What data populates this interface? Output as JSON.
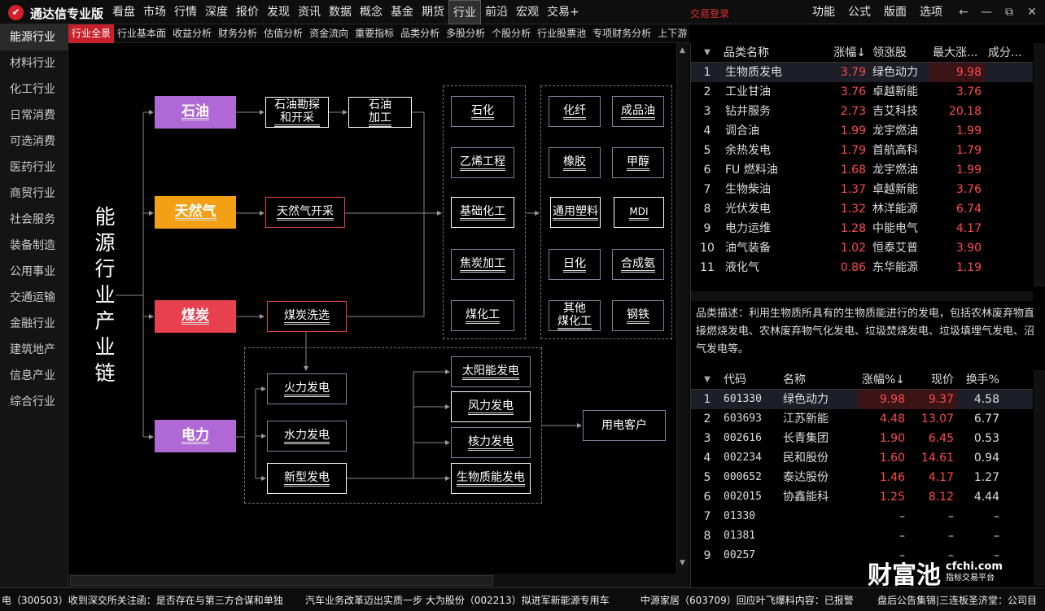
{
  "app": {
    "logo_glyph": "✔",
    "title": "通达信专业版"
  },
  "top_menu": [
    "看盘",
    "市场",
    "行情",
    "深度",
    "报价",
    "发现",
    "资讯",
    "数据",
    "概念",
    "基金",
    "期货",
    "行业",
    "前沿",
    "宏观",
    "交易+"
  ],
  "login_link": "交易登录",
  "right_menu": [
    "功能",
    "公式",
    "版面",
    "选项"
  ],
  "window_controls": [
    "←",
    "—",
    "⧉",
    "✕"
  ],
  "sidebar": [
    "能源行业",
    "材料行业",
    "化工行业",
    "日常消费",
    "可选消费",
    "医药行业",
    "商贸行业",
    "社会服务",
    "装备制造",
    "公用事业",
    "交通运输",
    "金融行业",
    "建筑地产",
    "信息产业",
    "综合行业"
  ],
  "sub_tabs": [
    "行业全景",
    "行业基本面",
    "收益分析",
    "财务分析",
    "估值分析",
    "资金流向",
    "重要指标",
    "品类分析",
    "多股分析",
    "个股分析",
    "行业股票池",
    "专项财务分析",
    "上下游"
  ],
  "diagram": {
    "chain_title": "能源行业产业链",
    "sources": {
      "oil": "石油",
      "gas": "天然气",
      "coal": "煤炭",
      "power": "电力"
    },
    "oil_steps": {
      "explore": "石油勘探\n和开采",
      "process": "石油\n加工"
    },
    "gas_step": "天然气开采",
    "coal_step": "煤炭洗选",
    "mid": [
      "石化",
      "乙烯工程",
      "基础化工",
      "焦炭加工",
      "煤化工"
    ],
    "products_left": [
      "化纤",
      "橡胶",
      "通用塑料",
      "日化",
      "其他\n煤化工"
    ],
    "products_right": [
      "成品油",
      "甲醇",
      "MDI",
      "合成氨",
      "钢铁"
    ],
    "power_gen": [
      "火力发电",
      "水力发电",
      "新型发电"
    ],
    "new_energy": [
      "太阳能发电",
      "风力发电",
      "核力发电",
      "生物质能发电"
    ],
    "customer": "用电客户"
  },
  "category_table": {
    "headers": {
      "name": "品类名称",
      "chg": "涨幅↓",
      "leader": "领涨股",
      "max": "最大涨...",
      "comp": "成分..."
    },
    "rows": [
      {
        "idx": "1",
        "name": "生物质发电",
        "chg": "3.79",
        "leader": "绿色动力",
        "max": "9.98"
      },
      {
        "idx": "2",
        "name": "工业甘油",
        "chg": "3.76",
        "leader": "卓越新能",
        "max": "3.76"
      },
      {
        "idx": "3",
        "name": "钻井服务",
        "chg": "2.73",
        "leader": "吉艾科技",
        "max": "20.18"
      },
      {
        "idx": "4",
        "name": "调合油",
        "chg": "1.99",
        "leader": "龙宇燃油",
        "max": "1.99"
      },
      {
        "idx": "5",
        "name": "余热发电",
        "chg": "1.79",
        "leader": "首航高科",
        "max": "1.79"
      },
      {
        "idx": "6",
        "name": "FU 燃料油",
        "chg": "1.68",
        "leader": "龙宇燃油",
        "max": "1.99"
      },
      {
        "idx": "7",
        "name": "生物柴油",
        "chg": "1.37",
        "leader": "卓越新能",
        "max": "3.76"
      },
      {
        "idx": "8",
        "name": "光伏发电",
        "chg": "1.32",
        "leader": "林洋能源",
        "max": "6.74"
      },
      {
        "idx": "9",
        "name": "电力运维",
        "chg": "1.28",
        "leader": "中能电气",
        "max": "4.17"
      },
      {
        "idx": "10",
        "name": "油气装备",
        "chg": "1.02",
        "leader": "恒泰艾普",
        "max": "3.90"
      },
      {
        "idx": "11",
        "name": "液化气",
        "chg": "0.86",
        "leader": "东华能源",
        "max": "1.19"
      }
    ]
  },
  "description": "品类描述：利用生物质所具有的生物质能进行的发电，包括农林废弃物直接燃烧发电、农林废弃物气化发电、垃圾焚烧发电、垃圾填埋气发电、沼气发电等。",
  "stock_table": {
    "headers": {
      "code": "代码",
      "name": "名称",
      "chg": "涨幅%↓",
      "price": "现价",
      "turnover": "换手%"
    },
    "rows": [
      {
        "idx": "1",
        "code": "601330",
        "name": "绿色动力",
        "chg": "9.98",
        "price": "9.37",
        "turnover": "4.58"
      },
      {
        "idx": "2",
        "code": "603693",
        "name": "江苏新能",
        "chg": "4.48",
        "price": "13.07",
        "turnover": "6.77"
      },
      {
        "idx": "3",
        "code": "002616",
        "name": "长青集团",
        "chg": "1.90",
        "price": "6.45",
        "turnover": "0.53"
      },
      {
        "idx": "4",
        "code": "002234",
        "name": "民和股份",
        "chg": "1.60",
        "price": "14.61",
        "turnover": "0.94"
      },
      {
        "idx": "5",
        "code": "000652",
        "name": "泰达股份",
        "chg": "1.46",
        "price": "4.17",
        "turnover": "1.27"
      },
      {
        "idx": "6",
        "code": "002015",
        "name": "协鑫能科",
        "chg": "1.25",
        "price": "8.12",
        "turnover": "4.44"
      },
      {
        "idx": "7",
        "code": "01330",
        "name": "",
        "chg": "–",
        "price": "–",
        "turnover": "–"
      },
      {
        "idx": "8",
        "code": "01381",
        "name": "",
        "chg": "–",
        "price": "–",
        "turnover": "–"
      },
      {
        "idx": "9",
        "code": "00257",
        "name": "",
        "chg": "–",
        "price": "–",
        "turnover": "–"
      }
    ]
  },
  "status_ticker": [
    "电（300503）收到深交所关注函：是否存在与第三方合谋和单独",
    "汽车业务改革迈出实质一步 大为股份（002213）拟进军新能源专用车",
    "中源家居（603709）回应叶飞爆料内容：已报警",
    "盘后公告集锦|三连板圣济堂：公司目"
  ],
  "watermark": {
    "main": "财富池",
    "url": "cfchi.com",
    "tag": "指标交易平台"
  },
  "colors": {
    "accent_red": "#c8202a",
    "up_red": "#ff4a4a",
    "leader_yellow": "#e6c200",
    "oil_purple": "#b068d6",
    "gas_orange": "#f4a015",
    "coal_red": "#e8404e"
  }
}
